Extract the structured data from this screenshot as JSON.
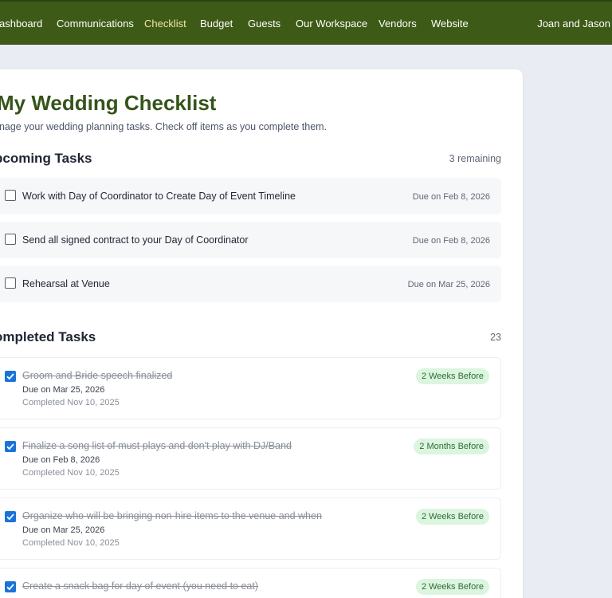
{
  "nav": {
    "items": [
      {
        "label": "ashboard"
      },
      {
        "label": "Communications"
      },
      {
        "label": "Checklist"
      },
      {
        "label": "Budget"
      },
      {
        "label": "Guests"
      },
      {
        "label": "Our Workspace"
      },
      {
        "label": "Vendors"
      },
      {
        "label": "Website"
      }
    ],
    "user": "Joan and Jason"
  },
  "page": {
    "title": "My Wedding Checklist",
    "subtitle": "anage your wedding planning tasks. Check off items as you complete them."
  },
  "upcoming": {
    "title": "pcoming Tasks",
    "count": "3 remaining",
    "tasks": [
      {
        "label": "Work with Day of Coordinator to Create Day of Event Timeline",
        "due": "Due on Feb 8, 2026"
      },
      {
        "label": "Send all signed contract to your Day of Coordinator",
        "due": "Due on Feb 8, 2026"
      },
      {
        "label": "Rehearsal at Venue",
        "due": "Due on Mar 25, 2026"
      }
    ]
  },
  "completed": {
    "title": "ompleted Tasks",
    "count": "23",
    "tasks": [
      {
        "label": "Groom and Bride speech finalized",
        "due": "Due on Mar 25, 2026",
        "completed": "Completed Nov 10, 2025",
        "badge": "2 Weeks Before"
      },
      {
        "label": "Finalize a song list of must plays and don't play with DJ/Band",
        "due": "Due on Feb 8, 2026",
        "completed": "Completed Nov 10, 2025",
        "badge": "2 Months Before"
      },
      {
        "label": "Organize who will be bringing non-hire items to the venue and when",
        "due": "Due on Mar 25, 2026",
        "completed": "Completed Nov 10, 2025",
        "badge": "2 Weeks Before"
      },
      {
        "label": "Create a snack bag for day of event (you need to eat)",
        "due": "",
        "completed": "",
        "badge": "2 Weeks Before"
      }
    ]
  },
  "colors": {
    "nav_bg": "#3d5a17",
    "nav_active": "#f2e6a4",
    "title": "#36541a",
    "checkbox_checked": "#1a73d9",
    "badge_bg": "#dcf5df",
    "badge_text": "#2f6b3a"
  }
}
